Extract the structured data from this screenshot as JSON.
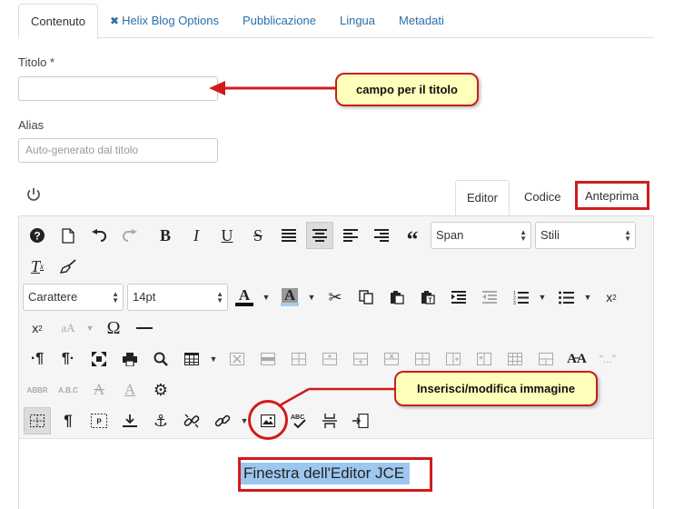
{
  "tabs": [
    {
      "label": "Contenuto",
      "active": true
    },
    {
      "label": "Helix Blog Options",
      "active": false,
      "icon": "joomla-icon"
    },
    {
      "label": "Pubblicazione",
      "active": false
    },
    {
      "label": "Lingua",
      "active": false
    },
    {
      "label": "Metadati",
      "active": false
    }
  ],
  "form": {
    "title_label": "Titolo *",
    "title_value": "",
    "alias_label": "Alias",
    "alias_placeholder": "Auto-generato dal titolo"
  },
  "callouts": {
    "title_field": "campo per il titolo",
    "image_button": "Inserisci/modifica immagine"
  },
  "editor_tabs": {
    "editor": "Editor",
    "code": "Codice",
    "preview": "Anteprima"
  },
  "toolbar": {
    "format_select": "Span",
    "styles_select": "Stili",
    "font_select": "Carattere",
    "size_select": "14pt",
    "font_color_letter": "A",
    "bg_color_letter": "A"
  },
  "content": {
    "text": "Finestra dell'Editor JCE"
  },
  "colors": {
    "accent": "#2a6fa8",
    "callout_bg": "#ffffbb",
    "callout_border": "#c81e1e",
    "selection": "#9dc7ee"
  }
}
